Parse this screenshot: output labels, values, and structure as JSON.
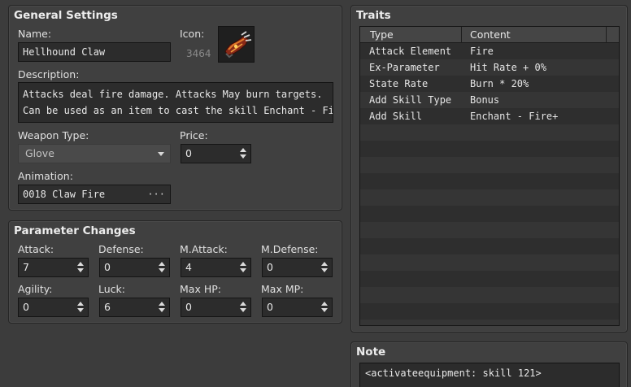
{
  "general": {
    "title": "General Settings",
    "name_label": "Name:",
    "name_value": "Hellhound Claw",
    "icon_label": "Icon:",
    "icon_index": "3464",
    "description_label": "Description:",
    "description_lines": [
      "Attacks deal fire damage. Attacks May burn targets.",
      "Can be used as an item to cast the skill Enchant - Fire+"
    ],
    "weapon_type_label": "Weapon Type:",
    "weapon_type_value": "Glove",
    "price_label": "Price:",
    "price_value": "0",
    "animation_label": "Animation:",
    "animation_value": "0018 Claw Fire",
    "animation_button": "···"
  },
  "parameters": {
    "title": "Parameter Changes",
    "items": [
      {
        "label": "Attack:",
        "value": "7"
      },
      {
        "label": "Defense:",
        "value": "0"
      },
      {
        "label": "M.Attack:",
        "value": "4"
      },
      {
        "label": "M.Defense:",
        "value": "0"
      },
      {
        "label": "Agility:",
        "value": "0"
      },
      {
        "label": "Luck:",
        "value": "6"
      },
      {
        "label": "Max HP:",
        "value": "0"
      },
      {
        "label": "Max MP:",
        "value": "0"
      }
    ]
  },
  "traits": {
    "title": "Traits",
    "columns": [
      "Type",
      "Content"
    ],
    "rows": [
      {
        "type": "Attack Element",
        "content": "Fire"
      },
      {
        "type": "Ex-Parameter",
        "content": "Hit Rate + 0%"
      },
      {
        "type": "State Rate",
        "content": "Burn * 20%"
      },
      {
        "type": "Add Skill Type",
        "content": "Bonus"
      },
      {
        "type": "Add Skill",
        "content": "Enchant - Fire+"
      }
    ]
  },
  "note": {
    "title": "Note",
    "value": "<activateequipment: skill 121>"
  },
  "icons": {
    "item_icon": "claw-gauntlet-icon",
    "combo": "chevron-down-icon",
    "spin": "spin-arrows-icon"
  }
}
